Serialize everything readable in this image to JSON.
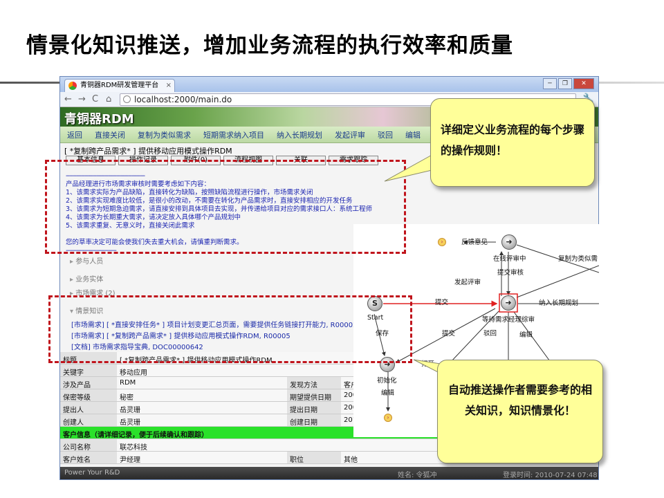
{
  "slide": {
    "title": "情景化知识推送，增加业务流程的执行效率和质量"
  },
  "browser": {
    "tab_title": "青铜器RDM研发管理平台",
    "url": "localhost:2000/main.do",
    "win_min": "─",
    "win_max": "❐",
    "win_close": "✕"
  },
  "app": {
    "brand": "青铜器RDM",
    "menu": [
      "返回",
      "直接关闭",
      "复制为类似需求",
      "短期需求纳入项目",
      "纳入长期规划",
      "发起评审",
      "驳回",
      "编辑"
    ],
    "breadcrumb": "[ *复制跨产品需求* ] 提供移动应用模式操作RDM",
    "tabs": [
      "基本信息",
      "操作记录",
      "附件(0)",
      "流程视图",
      "关联",
      "需求跟踪"
    ],
    "notice": {
      "divider": "-----------------------------------------------",
      "intro": "产品经理进行市场需求审核时需要考虑如下内容：",
      "rules": [
        "1、该需求实际为产品缺陷，直接转化为缺陷，按照缺陷流程进行操作，市场需求关闭",
        "2、该需求实现难度比较低，是很小的改动，不需要在转化为产品需求时，直接安排相应的开发任务",
        "3、该需求为短期急迫需求，请直接安排到具体项目去实现，并传递给项目对应的需求接口人：系统工程师",
        "4、该需求为长期重大需求，请决定放入具体哪个产品规划中",
        "5、该需求重复、无意义时，直接关闭此需求"
      ],
      "warning": "您的草率决定可能会使我们失去重大机会，请慎重判断需求。",
      "divider2": "------------------------------"
    },
    "sections": {
      "participants": "参与人员",
      "business_entity": "业务实体",
      "market_demand": "市场需求 (2)",
      "context_knowledge": "情景知识"
    },
    "knowledge_items": [
      "[市场需求] [ *直接安排任务* ] 项目计划变更汇总页面，需要提供任务链接打开能力, R00002",
      "[市场需求] [ *复制跨产品需求* ] 提供移动应用模式操作RDM, R00005",
      "[文档] 市场需求指导宝典, DOC00000642"
    ],
    "fields": {
      "title_label": "标题",
      "title_value": "[ *复制跨产品需求* ] 提供移动应用模式操作RDM",
      "keyword_label": "关键字",
      "keyword_value": "移动应用",
      "product_label": "涉及产品",
      "product_value": "RDM",
      "discover_label": "发现方法",
      "discover_value": "客户",
      "secret_label": "保密等级",
      "secret_value": "秘密",
      "expect_date_label": "期望提供日期",
      "expect_date_value": "200",
      "proposer_label": "提出人",
      "proposer_value": "岳灵珊",
      "propose_date_label": "提出日期",
      "propose_date_value": "200",
      "creator_label": "创建人",
      "creator_value": "岳灵珊",
      "create_date_label": "创建日期",
      "create_date_value": "201",
      "customer_header": "客户信息（请详细记录，便于后续确认和跟踪）",
      "company_label": "公司名称",
      "company_value": "联芯科技",
      "customer_label": "客户姓名",
      "customer_value": "尹经理",
      "position_label": "职位",
      "position_value": "其他"
    },
    "status": {
      "left": "Power Your R&D",
      "user": "姓名: 令狐冲",
      "time": "登录时间: 2010-07-24 07:48"
    }
  },
  "flow": {
    "start_label": "Start",
    "start_symbol": "S",
    "arrow_symbol": "➜",
    "labels": {
      "feedback": "反馈意见",
      "online_review": "在线评审中",
      "submit_review": "提交审核",
      "copy_similar": "复制为类似需",
      "start_review": "发起评审",
      "submit": "提交",
      "long_term": "纳入长期规划",
      "waiting": "等待需求经理综审",
      "save": "保存",
      "submit2": "提交",
      "reject": "驳回",
      "edit": "编辑",
      "open": "打开",
      "init": "初始化",
      "edit2": "编辑"
    }
  },
  "callouts": {
    "top": "详细定义业务流程的每个步骤的操作规则！",
    "bottom": "自动推送操作者需要参考的相关知识，知识情景化！"
  },
  "colors": {
    "accent_red": "#c0141c",
    "callout_yellow": "#ffff99",
    "notice_blue": "#1a23b0",
    "customer_green": "#2ae12a"
  }
}
